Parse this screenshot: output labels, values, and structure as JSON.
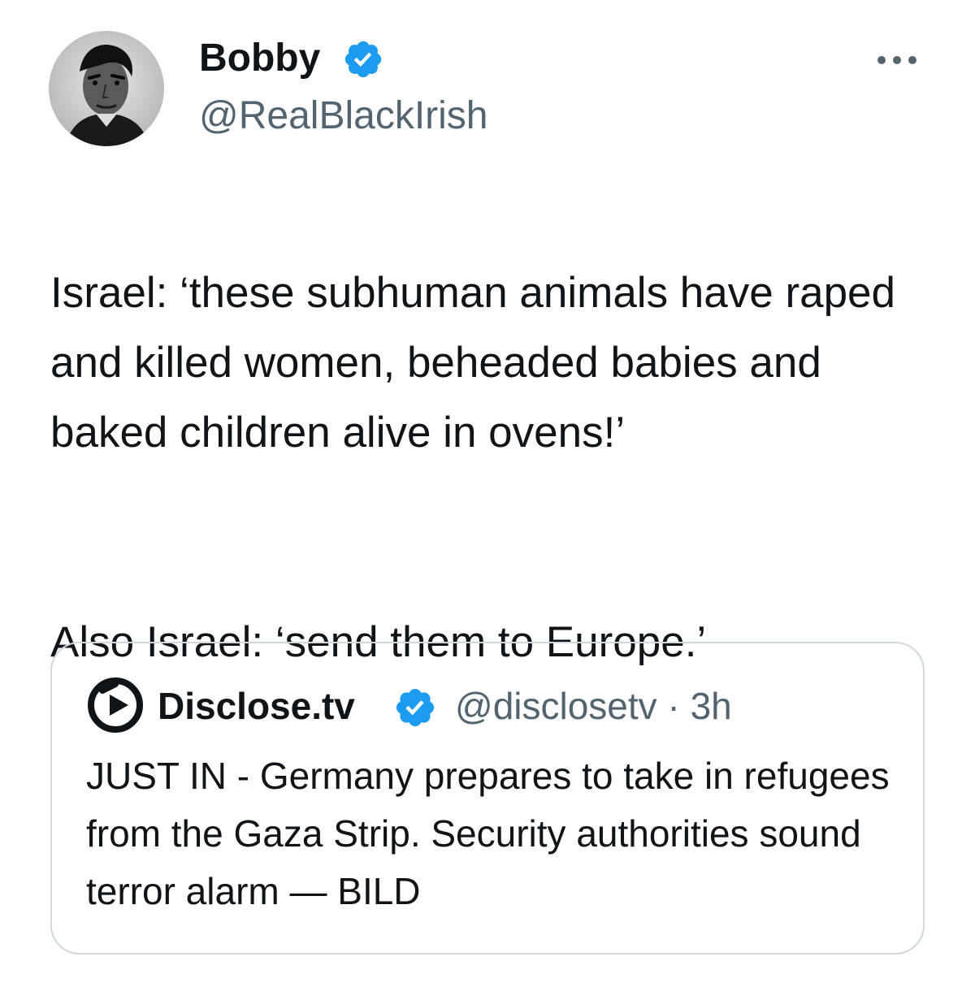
{
  "tweet": {
    "author": {
      "display_name": "Bobby",
      "handle": "@RealBlackIrish",
      "verified": true,
      "avatar": "avatar-portrait-bw"
    },
    "more_icon": "more-horizontal-icon",
    "body": {
      "paragraph1": "Israel: ‘these subhuman animals have raped and killed women, beheaded babies and baked children alive in ovens!’",
      "paragraph2": "Also Israel: ‘send them to Europe.’"
    },
    "quoted": {
      "logo": "disclose-tv-logo",
      "display_name": "Disclose.tv",
      "handle": "@disclosetv",
      "separator": "·",
      "time": "3h",
      "text": "JUST IN - Germany prepares to take in refugees from the Gaza Strip. Security authorities sound terror alarm — BILD",
      "verified": true
    }
  },
  "colors": {
    "verified_blue": "#1d9bf0",
    "secondary_text": "#536471",
    "border": "#cfd9de",
    "text": "#0f1419"
  }
}
